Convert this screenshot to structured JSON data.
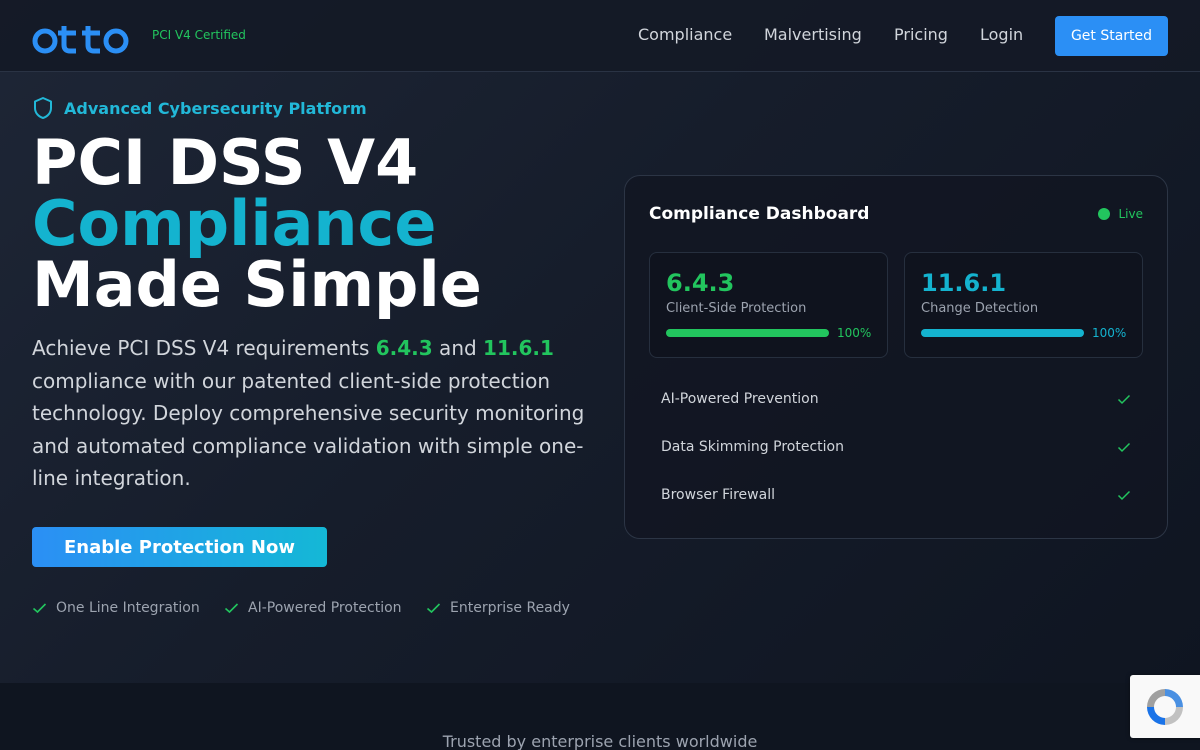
{
  "nav": {
    "logo_text": "otto",
    "certified_badge": "PCI V4 Certified",
    "links": [
      "Compliance",
      "Malvertising",
      "Pricing",
      "Login"
    ],
    "cta_label": "Get Started"
  },
  "hero": {
    "badge_text": "Advanced Cybersecurity Platform",
    "title_line1": "PCI DSS V4",
    "title_line2": "Compliance",
    "title_line3": "Made Simple",
    "desc_part1": "Achieve PCI DSS V4 requirements ",
    "desc_req1": "6.4.3",
    "desc_part2": " and ",
    "desc_req2": "11.6.1",
    "desc_part3": " compliance with our patented client-side protection technology. Deploy comprehensive security monitoring and automated compliance validation with simple one-line integration.",
    "cta_label": "Enable Protection Now",
    "features": [
      "One Line Integration",
      "AI-Powered Protection",
      "Enterprise Ready"
    ]
  },
  "dashboard": {
    "title": "Compliance Dashboard",
    "status": "Live",
    "cards": [
      {
        "code": "6.4.3",
        "label": "Client-Side Protection",
        "progress_percent": 100,
        "percent_text": "100%",
        "color": "#22c55e"
      },
      {
        "code": "11.6.1",
        "label": "Change Detection",
        "progress_percent": 100,
        "percent_text": "100%",
        "color": "#14b3cf"
      }
    ],
    "checklist": [
      "AI-Powered Prevention",
      "Data Skimming Protection",
      "Browser Firewall"
    ]
  },
  "lower": {
    "trusted_text": "Trusted by enterprise clients worldwide"
  },
  "colors": {
    "accent_blue": "#2b8ff5",
    "accent_cyan": "#14b3cf",
    "accent_green": "#22c55e",
    "background": "#111827"
  },
  "icons": [
    "shield-icon",
    "check-icon",
    "recaptcha-icon"
  ]
}
